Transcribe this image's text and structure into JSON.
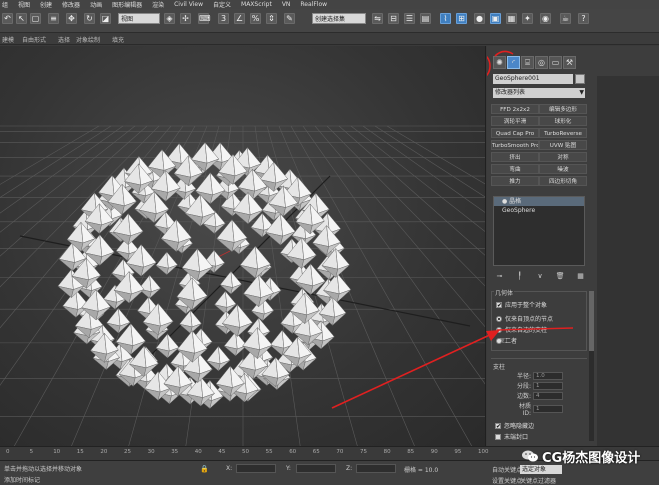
{
  "menubar": {
    "items": [
      "组",
      "视图",
      "创建",
      "修改器",
      "动画",
      "图形编辑器",
      "渲染",
      "Civil View",
      "自定义",
      "MAXScript",
      "VN",
      "RealFlow"
    ]
  },
  "toolbar": {
    "view_dropdown": "视图",
    "selection_set_dropdown": "创建选择集"
  },
  "ribbon": {
    "tabs": [
      "建模",
      "自由形式",
      "选择",
      "对象绘制",
      "填充"
    ]
  },
  "command_panel": {
    "tabs": [
      "create-icon",
      "modify-icon",
      "hierarchy-icon",
      "motion-icon",
      "display-icon",
      "utilities-icon"
    ],
    "active_tab": "modify-icon",
    "object_name": "GeoSphere001",
    "modifier_list_label": "修改器列表",
    "modifier_buttons": [
      "FFD 2x2x2",
      "编辑多边形",
      "涡轮平滑",
      "球形化",
      "Quad Cap Pro",
      "TurboReverse",
      "TurboSmooth Pro",
      "UVW 贴图",
      "挤出",
      "对称",
      "弯曲",
      "噪波",
      "推力",
      "四边形切角"
    ],
    "stack": [
      "晶格",
      "GeoSphere"
    ],
    "stack_selected": 0,
    "geometry": {
      "title": "几何体",
      "apply_whole_object": "应用于整个对象",
      "radio_joints_only": "仅来自顶点的节点",
      "radio_struts_only": "仅来自边的支柱",
      "radio_both": "二者",
      "selected_radio": "radio_joints_only"
    },
    "struts": {
      "title": "支柱",
      "radius_label": "半径:",
      "radius_value": "1.0",
      "segments_label": "分段:",
      "segments_value": "1",
      "sides_label": "边数:",
      "sides_value": "4",
      "material_id_label": "材质 ID:",
      "material_id_value": "1",
      "ignore_hidden_edges": "忽略隐藏边",
      "end_caps": "末端封口"
    }
  },
  "annotations": {
    "circle_1": "1",
    "circle_2": "2",
    "accent_color": "#e02020"
  },
  "timeline": {
    "ticks": [
      "0",
      "5",
      "10",
      "15",
      "20",
      "25",
      "30",
      "35",
      "40",
      "45",
      "50",
      "55",
      "60",
      "65",
      "70",
      "75",
      "80",
      "85",
      "90",
      "95",
      "100"
    ]
  },
  "statusbar": {
    "x_label": "X:",
    "y_label": "Y:",
    "z_label": "Z:",
    "grid_label": "栅格 = 10.0",
    "auto_key_label": "自动关键点",
    "set_key_label": "设置关键点",
    "selected_object_dropdown": "选定对象",
    "key_filters_label": "关键点过滤器",
    "left_status": "单击并拖动以选择并移动对象",
    "add_time_tag": "添加时间标记"
  },
  "watermark": {
    "text": "CG杨杰图像设计"
  }
}
